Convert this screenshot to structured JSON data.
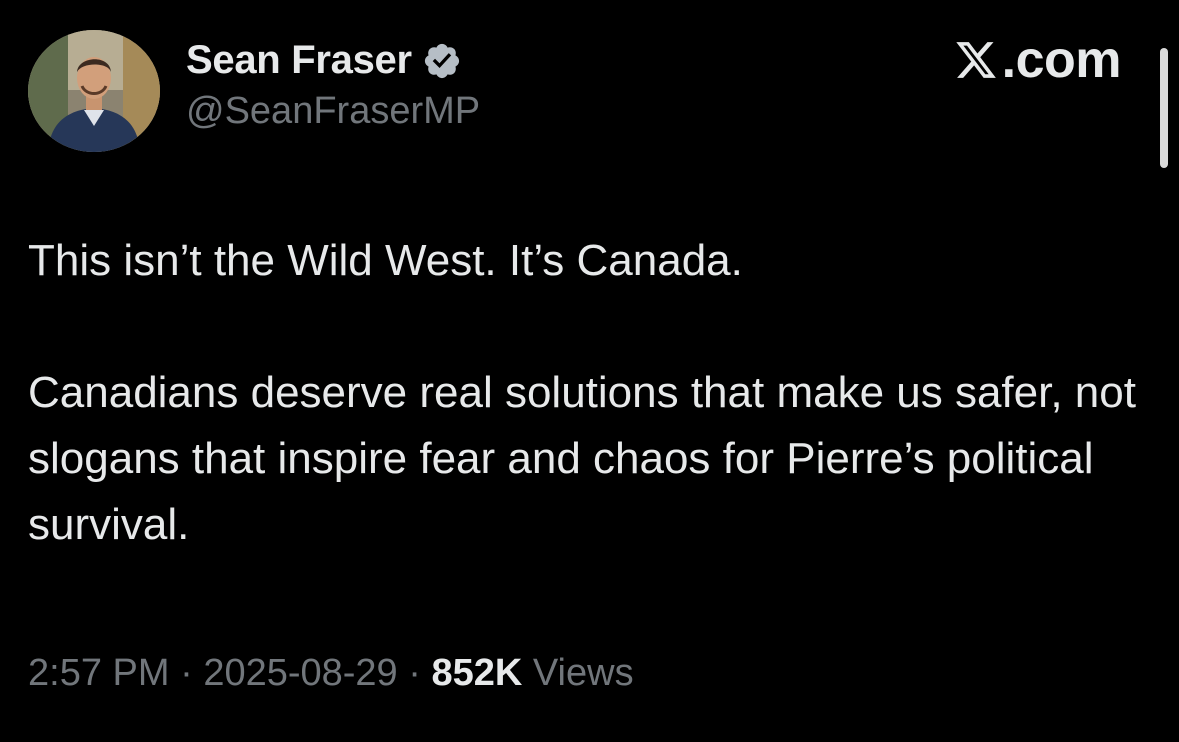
{
  "author": {
    "display_name": "Sean Fraser",
    "handle": "@SeanFraserMP",
    "verified_icon": "verified-badge-icon",
    "verified_color": "#b6bec6",
    "avatar_icon": "profile-photo"
  },
  "brand": {
    "logo_icon": "x-logo-icon",
    "suffix": ".com"
  },
  "tweet": {
    "paragraphs": [
      "This isn’t the Wild West. It’s Canada.",
      "Canadians deserve real solutions that make us safer, not slogans that inspire fear and chaos for Pierre’s political survival."
    ]
  },
  "meta": {
    "time": "2:57 PM",
    "separator": " · ",
    "date": "2025-08-29",
    "views_count": "852K",
    "views_label": " Views"
  },
  "colors": {
    "background": "#000000",
    "primary_text": "#e7e9ea",
    "secondary_text": "#71767b"
  }
}
